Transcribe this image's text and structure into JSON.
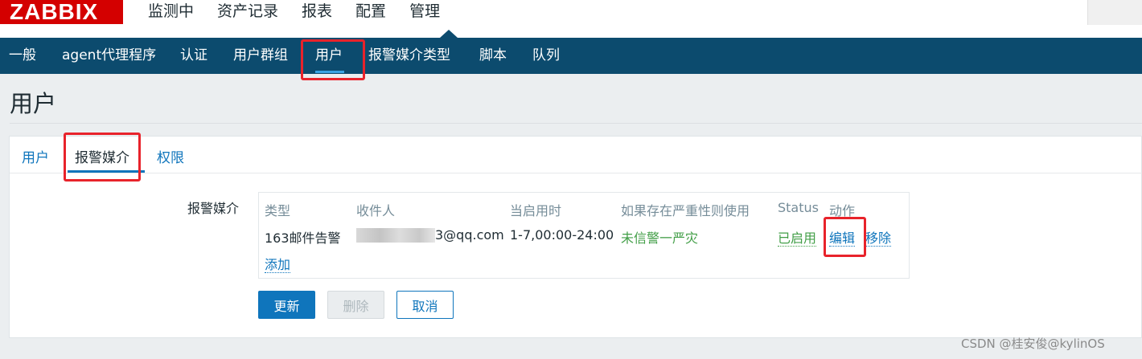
{
  "brand": {
    "logo": "ZABBIX"
  },
  "top_nav": [
    "监测中",
    "资产记录",
    "报表",
    "配置",
    "管理"
  ],
  "sub_nav": [
    "一般",
    "agent代理程序",
    "认证",
    "用户群组",
    "用户",
    "报警媒介类型",
    "脚本",
    "队列"
  ],
  "page": {
    "title": "用户"
  },
  "tabs": [
    "用户",
    "报警媒介",
    "权限"
  ],
  "form": {
    "media_label": "报警媒介"
  },
  "media_table": {
    "headers": [
      "类型",
      "收件人",
      "当启用时",
      "如果存在严重性则使用",
      "Status",
      "动作"
    ],
    "row": {
      "type": "163邮件告警",
      "recipient_visible": "3@qq.com",
      "when_active": "1-7,00:00-24:00",
      "severity": "未信警一严灾",
      "status": "已启用",
      "edit": "编辑",
      "remove": "移除"
    },
    "add_link": "添加"
  },
  "buttons": {
    "update": "更新",
    "delete": "删除",
    "cancel": "取消"
  },
  "watermark": "CSDN @桂安俊@kylinOS",
  "colors": {
    "nav_bg": "#0c4b6e",
    "link": "#0f75bc",
    "green": "#429e47",
    "highlight": "#e8232b",
    "logo_bg": "#d40000"
  }
}
